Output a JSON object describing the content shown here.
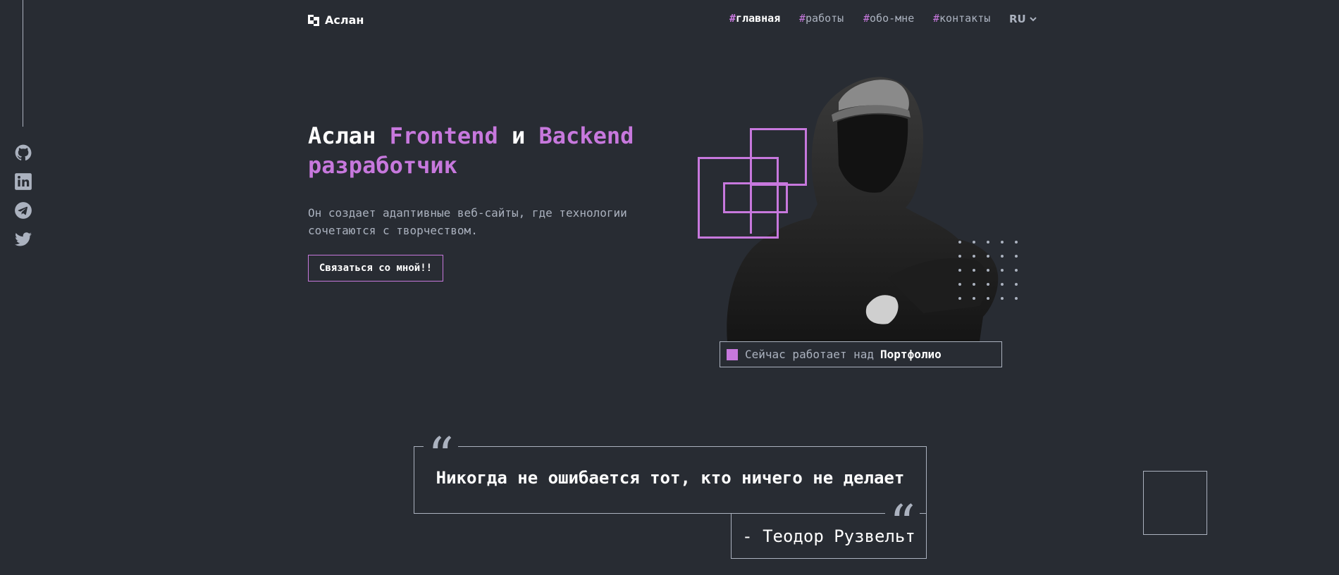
{
  "brand": {
    "name": "Аслан"
  },
  "nav": {
    "items": [
      {
        "hash": "#",
        "label": "главная",
        "active": true
      },
      {
        "hash": "#",
        "label": "работы"
      },
      {
        "hash": "#",
        "label": "обо-мне"
      },
      {
        "hash": "#",
        "label": "контакты"
      }
    ],
    "language": "RU"
  },
  "social": [
    "github-icon",
    "linkedin-icon",
    "telegram-icon",
    "twitter-icon"
  ],
  "hero": {
    "name": "Аслан",
    "frontend": "Frontend",
    "and": "и",
    "backend": "Backend",
    "role": "разработчик",
    "description": "Он создает адаптивные веб-сайты, где технологии сочетаются с творчеством.",
    "cta_label": "Связаться со мной!!"
  },
  "status": {
    "prefix": "Сейчас работает над",
    "project": "Портфолио"
  },
  "quote": {
    "text": "Никогда не ошибается тот, кто ничего не делает",
    "author": "- Теодор Рузвельт"
  },
  "colors": {
    "background": "#282c33",
    "accent": "#c778dd",
    "text": "#abb2bf",
    "white": "#ffffff"
  }
}
